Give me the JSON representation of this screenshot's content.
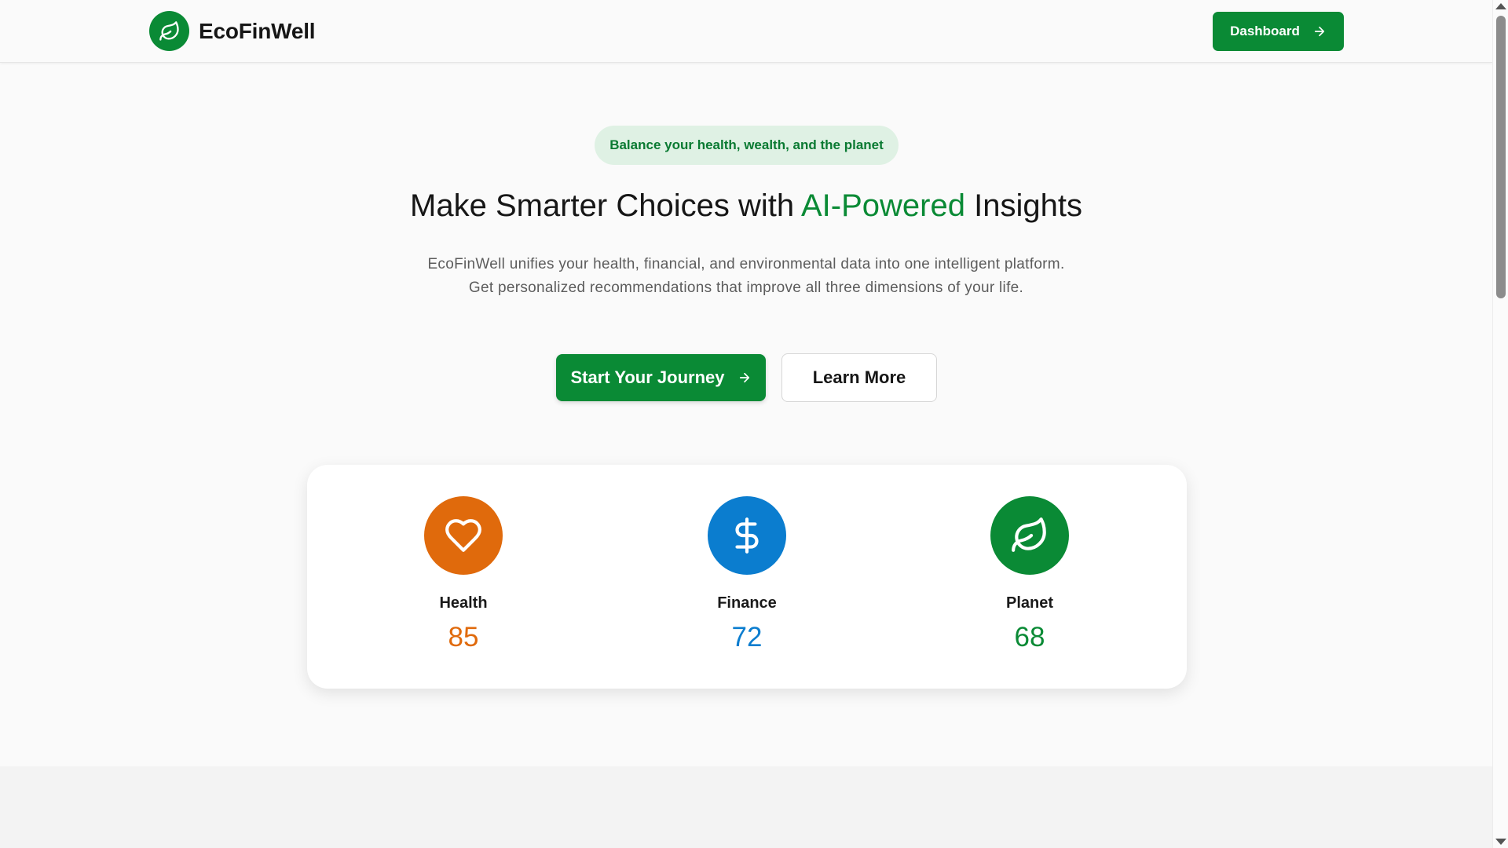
{
  "header": {
    "brand_name": "EcoFinWell",
    "brand_icon": "leaf-icon",
    "dashboard_label": "Dashboard",
    "dashboard_icon": "arrow-right-icon"
  },
  "hero": {
    "tagline": "Balance your health, wealth, and the planet",
    "title_prefix": "Make Smarter Choices with ",
    "title_accent": "AI-Powered",
    "title_suffix": " Insights",
    "description": "EcoFinWell unifies your health, financial, and environmental data into one intelligent platform. Get personalized recommendations that improve all three dimensions of your life.",
    "primary_cta": "Start Your Journey",
    "primary_cta_icon": "arrow-right-icon",
    "secondary_cta": "Learn More"
  },
  "scores": [
    {
      "label": "Health",
      "value": "85",
      "icon": "heart-icon",
      "color": "#e06a0c"
    },
    {
      "label": "Finance",
      "value": "72",
      "icon": "dollar-icon",
      "color": "#0b7dcf"
    },
    {
      "label": "Planet",
      "value": "68",
      "icon": "leaf-icon",
      "color": "#0a8a35"
    }
  ],
  "colors": {
    "brand_green": "#0a8a35",
    "pill_bg": "#dff1e4",
    "health_orange": "#e06a0c",
    "finance_blue": "#0b7dcf",
    "planet_green": "#0a8a35"
  }
}
